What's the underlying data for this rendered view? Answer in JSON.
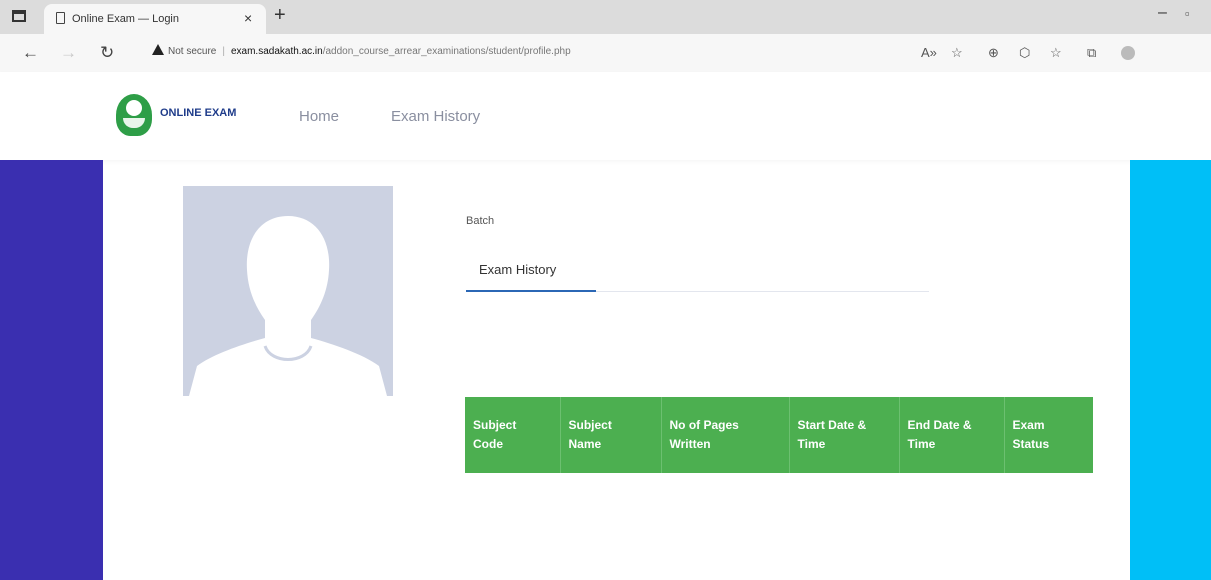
{
  "browser": {
    "tab_title": "Online Exam — Login",
    "tab_close": "×",
    "new_tab": "+",
    "minimize": "–",
    "restore": "▫",
    "back": "←",
    "forward": "→",
    "reload": "↻",
    "security_label": "Not secure",
    "separator": "|",
    "url_host": "exam.sadakath.ac.in",
    "url_path": "/addon_course_arrear_examinations/student/profile.php",
    "toolbar": [
      "A»",
      "☆",
      "⊕",
      "⬡",
      "☆",
      "⧉"
    ]
  },
  "header": {
    "logo_text": "ONLINE EXAM",
    "nav": [
      "Home",
      "Exam History"
    ]
  },
  "profile": {
    "batch_label": "Batch",
    "tabs": [
      "Exam History"
    ]
  },
  "exam_table": {
    "columns": [
      [
        "Subject",
        "Code"
      ],
      [
        "Subject",
        "Name"
      ],
      [
        "No of Pages",
        "Written"
      ],
      [
        "Start Date &",
        "Time"
      ],
      [
        "End Date &",
        "Time"
      ],
      [
        "Exam",
        "Status"
      ]
    ]
  },
  "colors": {
    "left_band": "#3a2fb0",
    "right_band": "#00bff7",
    "table_header": "#4caf50",
    "tab_underline": "#2b67b5"
  }
}
